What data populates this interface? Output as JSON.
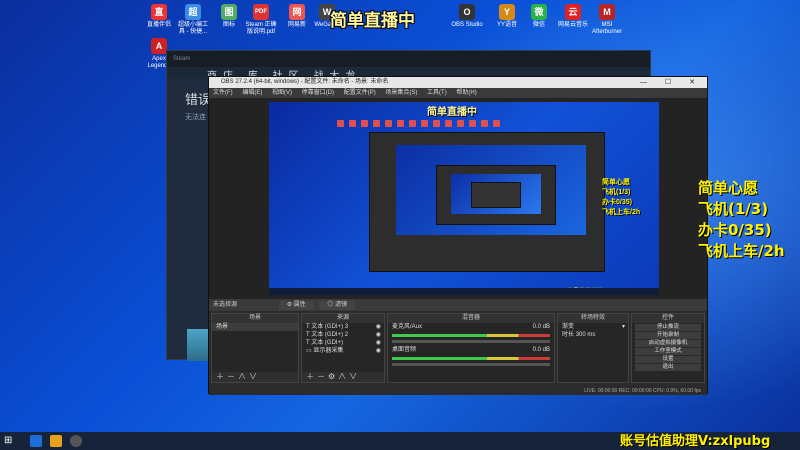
{
  "overlay": {
    "title": "简单直播中",
    "side_lines": [
      "简单心愿",
      "飞机(1/3)",
      "办卡0/35)",
      "飞机上车/2h"
    ],
    "footer": "账号估值助理V:zxlpubg"
  },
  "desktop_icons": [
    {
      "label": "直播伴侣",
      "glyph": "直",
      "color": "#e33"
    },
    {
      "label": "超级小编工具 - 快捷...",
      "glyph": "超",
      "color": "#3a8de0"
    },
    {
      "label": "图标",
      "glyph": "图",
      "color": "#5a6"
    },
    {
      "label": "Steam 正确 版说明.pdf",
      "glyph": "PDF",
      "color": "#d33"
    },
    {
      "label": "网易新",
      "glyph": "网",
      "color": "#e55"
    },
    {
      "label": "WeGame",
      "glyph": "W",
      "color": "#444"
    },
    {
      "label": "OBS Studio",
      "glyph": "O",
      "color": "#333"
    },
    {
      "label": "YY语音",
      "glyph": "Y",
      "color": "#d48a1a"
    },
    {
      "label": "微信",
      "glyph": "微",
      "color": "#2ab24a"
    },
    {
      "label": "网易云音乐",
      "glyph": "云",
      "color": "#d22"
    },
    {
      "label": "MSI Afterburner",
      "glyph": "M",
      "color": "#b22"
    }
  ],
  "second_row_label": "Apex Legends",
  "steam": {
    "nav": "商店 库 社区 战大龙",
    "error_title": "错误",
    "error_sub": "无法连"
  },
  "obs": {
    "title": "OBS 27.2.4 (64-bit, windows) - 配置文件: 未命名 - 场景: 未命名",
    "menu": [
      "文件(F)",
      "编辑(E)",
      "视图(V)",
      "停靠窗口(D)",
      "配置文件(P)",
      "场景集合(S)",
      "工具(T)",
      "帮助(H)"
    ],
    "scene_bar_label": "未选择源",
    "scene_bar_btn1": "属性",
    "scene_bar_btn2": "滤镜",
    "scenes_head": "场景",
    "scenes": [
      "场景"
    ],
    "sources_head": "来源",
    "sources": [
      "文本 (GDI+) 3",
      "文本 (GDI+) 2",
      "文本 (GDI+)",
      "显示器采集"
    ],
    "mixer_head": "混音器",
    "mixer_tracks": [
      {
        "name": "麦克风/Aux",
        "db": "0.0 dB"
      },
      {
        "name": "桌面音频",
        "db": "0.0 dB"
      }
    ],
    "transition_head": "转场特效",
    "transition_value": "渐变",
    "duration_label": "时长",
    "duration_value": "300 ms",
    "controls_head": "控件",
    "controls": [
      "停止推流",
      "开始录制",
      "启动虚拟摄像机",
      "工作室模式",
      "设置",
      "退出"
    ],
    "status": "LIVE: 00:00:00   REC: 00:00:00   CPU: 0.9%, 60.00 fps"
  },
  "colors": {
    "overlay_yellow": "#fff200",
    "obs_dark": "#2b2b2b",
    "desktop_blue": "#0a4fd6"
  }
}
